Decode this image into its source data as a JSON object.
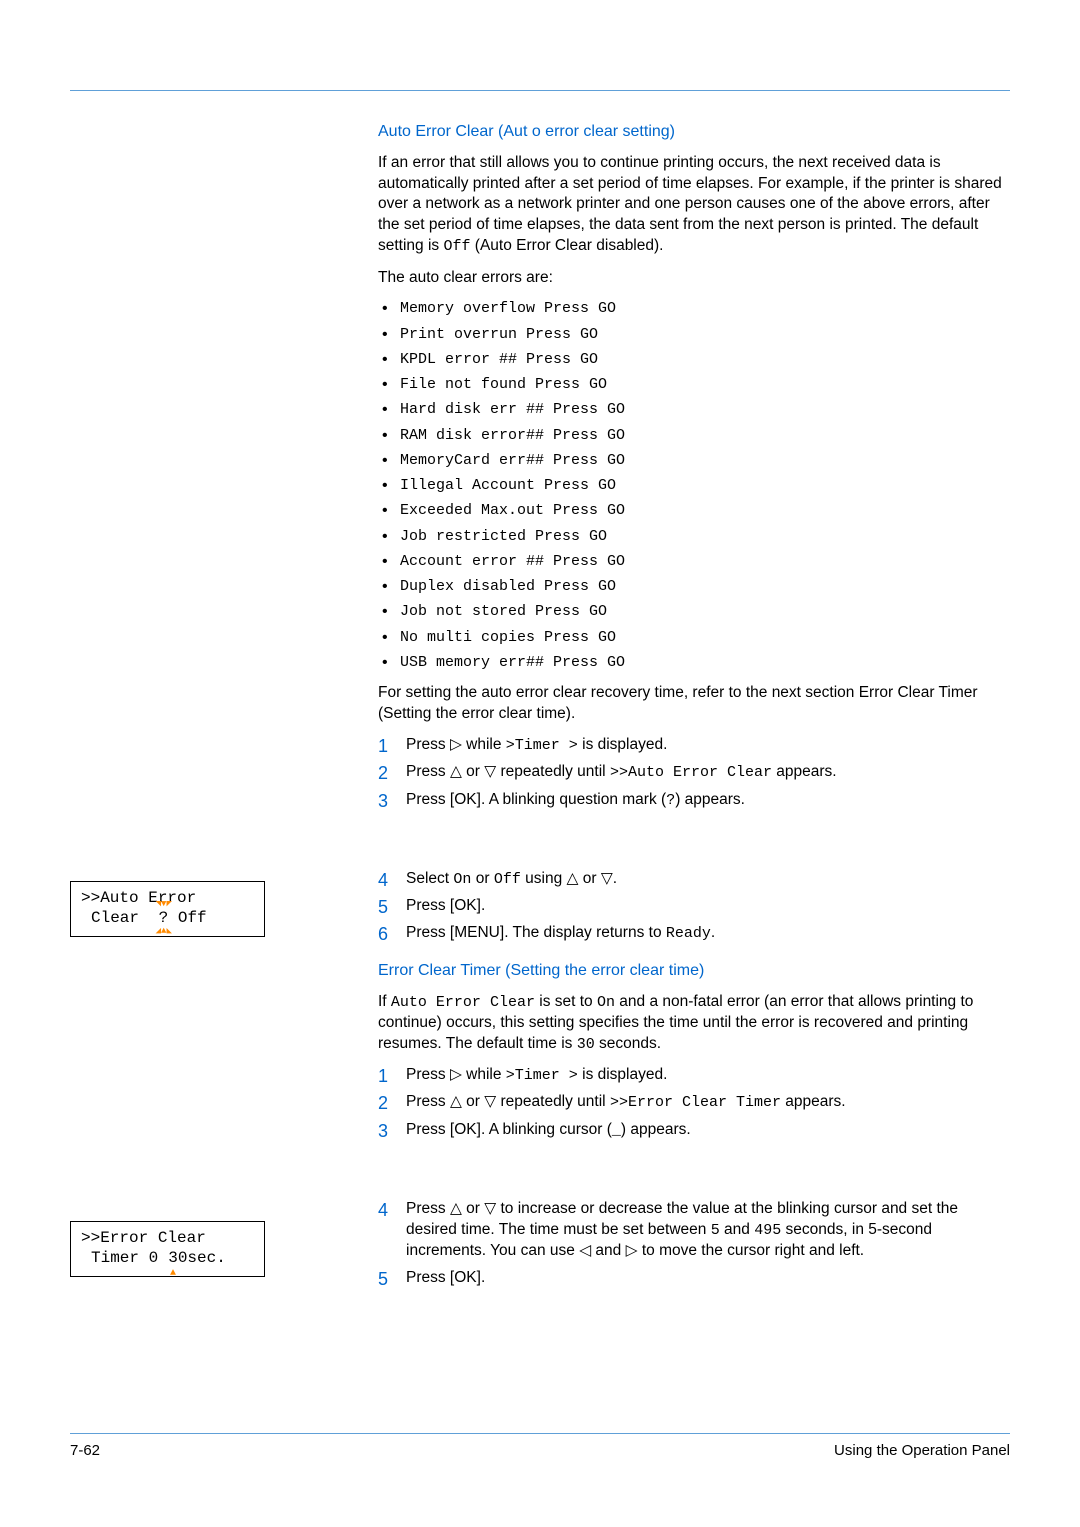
{
  "section1": {
    "title": "Auto Error Clear (Aut   o error clear setting)",
    "intro": "If an error that still allows you to continue printing occurs, the next received data is automatically printed after a set period of time elapses. For example, if the printer is shared over a network as a network printer and one person causes one of the above errors, after the set period of time elapses, the data sent from the next person is printed. The default setting is ",
    "intro_code": "Off",
    "intro_tail": " (Auto Error Clear disabled).",
    "list_intro": "The auto clear errors are:",
    "errors": [
      "Memory overflow Press GO",
      "Print overrun Press GO",
      "KPDL error    ## Press GO",
      "File not found Press GO",
      "Hard disk err ## Press GO",
      "RAM disk error## Press GO",
      "MemoryCard err## Press GO",
      "Illegal Account Press GO",
      "Exceeded Max.out Press GO",
      "Job restricted Press GO",
      "Account error ## Press GO",
      "Duplex disabled Press GO",
      "Job not stored Press GO",
      "No multi copies Press GO",
      "USB memory err## Press GO"
    ],
    "after_list": "For setting the auto error clear recovery time, refer to the next section Error Clear Timer (Setting the error clear time).",
    "steps": {
      "s1a": "Press ",
      "s1b": " while ",
      "s1c": ">Timer  >",
      "s1d": " is displayed.",
      "s2a": "Press ",
      "s2b": " or ",
      "s2c": " repeatedly until ",
      "s2d": ">>Auto Error Clear",
      "s2e": " appears.",
      "s3a": "Press [",
      "s3b": "OK]",
      "s3c": ". A blinking question mark (",
      "s3d": "?",
      "s3e": ") appears.",
      "s4a": "Select ",
      "s4b": "On",
      "s4c": " or ",
      "s4d": "Off",
      "s4e": " using ",
      "s4f": " or ",
      "s4g": ".",
      "s5a": "Press [",
      "s5b": "OK]",
      "s5c": ".",
      "s6a": "Press [",
      "s6b": "MENU]",
      "s6c": ". The display returns to ",
      "s6d": "Ready",
      "s6e": "."
    },
    "lcd": {
      "line1": ">>Auto Error",
      "line2a": " Clear",
      "line2q": "?",
      "line2b": " Off"
    }
  },
  "section2": {
    "title": "Error Clear Timer (Setting the error clear time)",
    "intro_a": "If ",
    "intro_b": "Auto Error Clear",
    "intro_c": " is set to ",
    "intro_d": "On",
    "intro_e": " and a non-fatal error (an error that allows printing to continue) occurs, this setting specifies the time until the error is recovered and printing resumes. The default time is ",
    "intro_f": "30",
    "intro_g": " seconds.",
    "steps": {
      "s1a": "Press ",
      "s1b": " while ",
      "s1c": ">Timer  >",
      "s1d": " is displayed.",
      "s2a": "Press ",
      "s2b": " or ",
      "s2c": " repeatedly until ",
      "s2d": ">>Error Clear Timer",
      "s2e": " appears.",
      "s3a": "Press [",
      "s3b": "OK]",
      "s3c": ". A blinking cursor (",
      "s3d": "_",
      "s3e": ") appears.",
      "s4a": "Press ",
      "s4b": " or ",
      "s4c": " to increase or decrease the value at the blinking cursor and set the desired time. The time must be set between ",
      "s4d": "5",
      "s4e": " and ",
      "s4f": "495",
      "s4g": " seconds, in 5-second increments. You can use ",
      "s4h": " and ",
      "s4i": " to move the cursor right and left.",
      "s5a": "Press [",
      "s5b": "OK]",
      "s5c": "."
    },
    "lcd": {
      "line1": ">>Error Clear",
      "line2a": " Timer   0",
      "line2b": "3",
      "line2c": "0sec."
    }
  },
  "footer": {
    "page": "7-62",
    "title": "Using the Operation Panel"
  },
  "glyph": {
    "r": "▷",
    "l": "◁",
    "u": "△",
    "d": "▽"
  }
}
